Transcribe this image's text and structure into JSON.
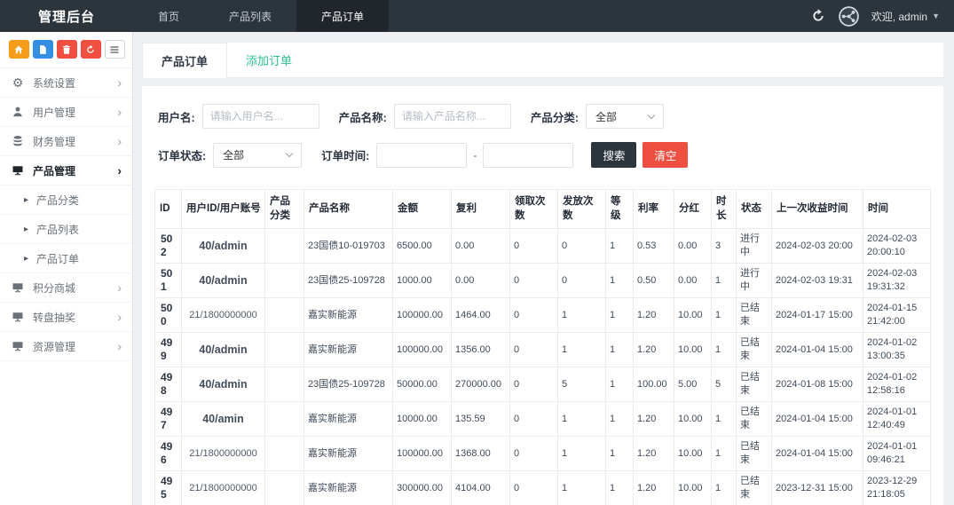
{
  "topbar": {
    "brand": "管理后台",
    "nav": [
      {
        "key": "home",
        "label": "首页",
        "active": false
      },
      {
        "key": "product-list",
        "label": "产品列表",
        "active": false
      },
      {
        "key": "product-orders",
        "label": "产品订单",
        "active": true
      }
    ],
    "welcome": "欢迎, admin"
  },
  "sidebar": {
    "quick_buttons": [
      {
        "key": "home",
        "icon": "home"
      },
      {
        "key": "file",
        "icon": "file"
      },
      {
        "key": "trash",
        "icon": "trash"
      },
      {
        "key": "recycle",
        "icon": "recycle"
      },
      {
        "key": "list",
        "icon": "list"
      }
    ],
    "menu": [
      {
        "key": "system-settings",
        "label": "系统设置",
        "icon": "gears",
        "expandable": true,
        "active": false,
        "sub": false
      },
      {
        "key": "user-management",
        "label": "用户管理",
        "icon": "user",
        "expandable": true,
        "active": false,
        "sub": false
      },
      {
        "key": "finance-management",
        "label": "财务管理",
        "icon": "database",
        "expandable": true,
        "active": false,
        "sub": false
      },
      {
        "key": "product-management",
        "label": "产品管理",
        "icon": "monitor",
        "expandable": true,
        "active": true,
        "sub": false
      },
      {
        "key": "product-category",
        "label": "产品分类",
        "icon": null,
        "expandable": false,
        "active": false,
        "sub": true
      },
      {
        "key": "product-list",
        "label": "产品列表",
        "icon": null,
        "expandable": false,
        "active": false,
        "sub": true
      },
      {
        "key": "product-orders",
        "label": "产品订单",
        "icon": null,
        "expandable": false,
        "active": false,
        "sub": true
      },
      {
        "key": "points-mall",
        "label": "积分商城",
        "icon": "monitor",
        "expandable": true,
        "active": false,
        "sub": false
      },
      {
        "key": "lucky-wheel",
        "label": "转盘抽奖",
        "icon": "monitor",
        "expandable": true,
        "active": false,
        "sub": false
      },
      {
        "key": "resource-management",
        "label": "资源管理",
        "icon": "monitor",
        "expandable": true,
        "active": false,
        "sub": false
      }
    ]
  },
  "tabs": [
    {
      "key": "product-orders",
      "label": "产品订单",
      "active": true
    },
    {
      "key": "add-order",
      "label": "添加订单",
      "active": false
    }
  ],
  "filters": {
    "username_label": "用户名:",
    "username_placeholder": "请输入用户名...",
    "product_label": "产品名称:",
    "product_placeholder": "请输入产品名称...",
    "category_label": "产品分类:",
    "category_value": "全部",
    "status_label": "订单状态:",
    "status_value": "全部",
    "time_label": "订单时间:",
    "time_separator": "-",
    "search_button": "搜索",
    "clear_button": "清空"
  },
  "table": {
    "headers": [
      "ID",
      "用户ID/用户账号",
      "产品分类",
      "产品名称",
      "金额",
      "复利",
      "领取次数",
      "发放次数",
      "等级",
      "利率",
      "分红",
      "时长",
      "状态",
      "上一次收益时间",
      "时间"
    ],
    "rows": [
      {
        "user_bold": true,
        "cells": [
          "502",
          "40/admin",
          "",
          "23国债10-019703",
          "6500.00",
          "0.00",
          "0",
          "0",
          "1",
          "0.53",
          "0.00",
          "3",
          "进行中",
          "2024-02-03 20:00",
          "2024-02-03 20:00:10"
        ]
      },
      {
        "user_bold": true,
        "cells": [
          "501",
          "40/admin",
          "",
          "23国债25-109728",
          "1000.00",
          "0.00",
          "0",
          "0",
          "1",
          "0.50",
          "0.00",
          "1",
          "进行中",
          "2024-02-03 19:31",
          "2024-02-03 19:31:32"
        ]
      },
      {
        "user_bold": false,
        "cells": [
          "500",
          "21/1800000000",
          "",
          "嘉实新能源",
          "100000.00",
          "1464.00",
          "0",
          "1",
          "1",
          "1.20",
          "10.00",
          "1",
          "已结束",
          "2024-01-17 15:00",
          "2024-01-15 21:42:00"
        ]
      },
      {
        "user_bold": true,
        "cells": [
          "499",
          "40/admin",
          "",
          "嘉实新能源",
          "100000.00",
          "1356.00",
          "0",
          "1",
          "1",
          "1.20",
          "10.00",
          "1",
          "已结束",
          "2024-01-04 15:00",
          "2024-01-02 13:00:35"
        ]
      },
      {
        "user_bold": true,
        "cells": [
          "498",
          "40/admin",
          "",
          "23国债25-109728",
          "50000.00",
          "270000.00",
          "0",
          "5",
          "1",
          "100.00",
          "5.00",
          "5",
          "已结束",
          "2024-01-08 15:00",
          "2024-01-02 12:58:16"
        ]
      },
      {
        "user_bold": true,
        "cells": [
          "497",
          "40/amin",
          "",
          "嘉实新能源",
          "10000.00",
          "135.59",
          "0",
          "1",
          "1",
          "1.20",
          "10.00",
          "1",
          "已结束",
          "2024-01-04 15:00",
          "2024-01-01 12:40:49"
        ]
      },
      {
        "user_bold": false,
        "cells": [
          "496",
          "21/1800000000",
          "",
          "嘉实新能源",
          "100000.00",
          "1368.00",
          "0",
          "1",
          "1",
          "1.20",
          "10.00",
          "1",
          "已结束",
          "2024-01-04 15:00",
          "2024-01-01 09:46:21"
        ]
      },
      {
        "user_bold": false,
        "cells": [
          "495",
          "21/1800000000",
          "",
          "嘉实新能源",
          "300000.00",
          "4104.00",
          "0",
          "1",
          "1",
          "1.20",
          "10.00",
          "1",
          "已结束",
          "2023-12-31 15:00",
          "2023-12-29 21:18:05"
        ]
      }
    ]
  },
  "theme": {
    "navbar_bg": "#2d353c",
    "navbar_active_bg": "#20262c",
    "tab_green": "#2ec194",
    "danger_red": "#ee4f41",
    "warning_orange": "#f59c1a",
    "info_blue": "#348fe2"
  }
}
